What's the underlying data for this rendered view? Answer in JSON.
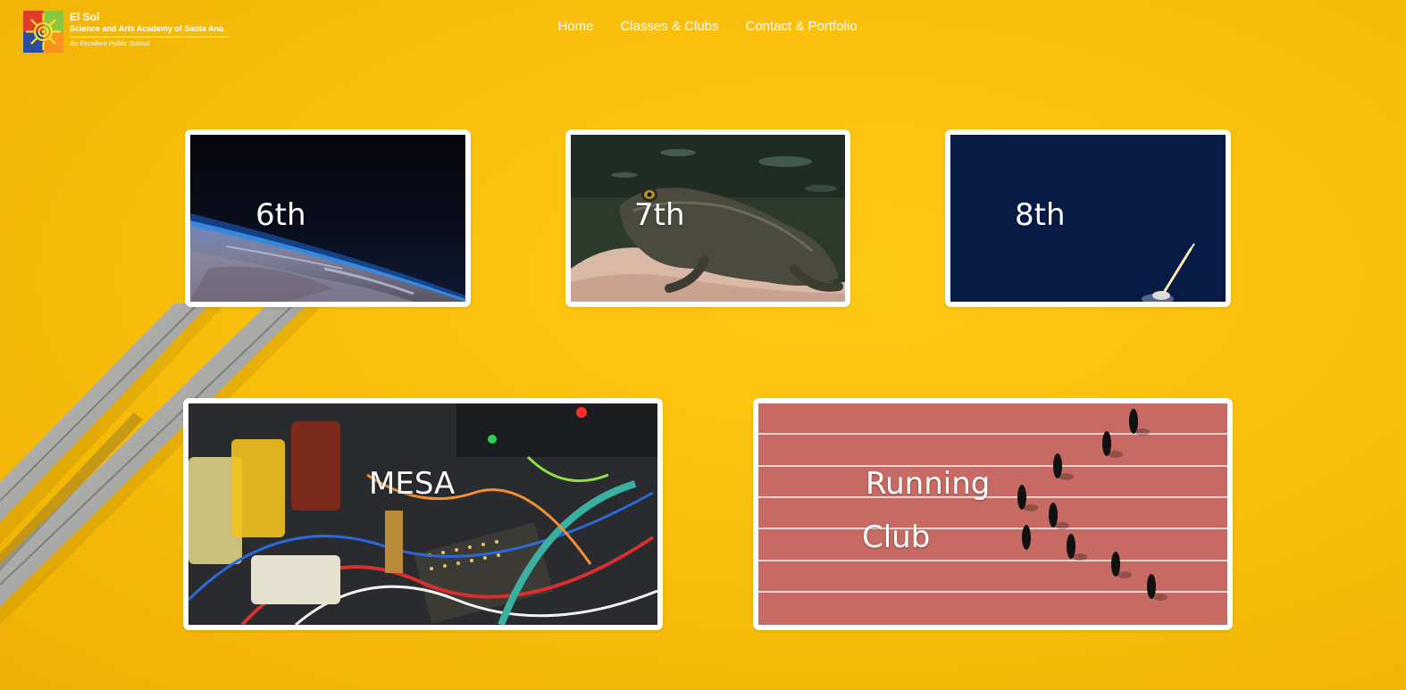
{
  "school": {
    "name": "El Sol",
    "subtitle": "Science and Arts Academy of Santa Ana",
    "tagline": "An Excellent Public School"
  },
  "nav": {
    "items": [
      "Home",
      "Classes & Clubs",
      "Contact & Portfolio"
    ]
  },
  "cards": {
    "sixth": {
      "label": "6th",
      "image": "earth-from-space"
    },
    "seventh": {
      "label": "7th",
      "image": "frog-in-hand"
    },
    "eighth": {
      "label": "8th",
      "image": "rocket-launch-night-sky"
    },
    "mesa": {
      "label": "MESA",
      "image": "electronics-wires-beakers"
    },
    "running": {
      "line1": "Running",
      "line2": "Club",
      "image": "runners-on-track-aerial"
    }
  },
  "colors": {
    "background": "#f8bd0a",
    "card_border": "#ffffff",
    "text": "#ffffff"
  }
}
